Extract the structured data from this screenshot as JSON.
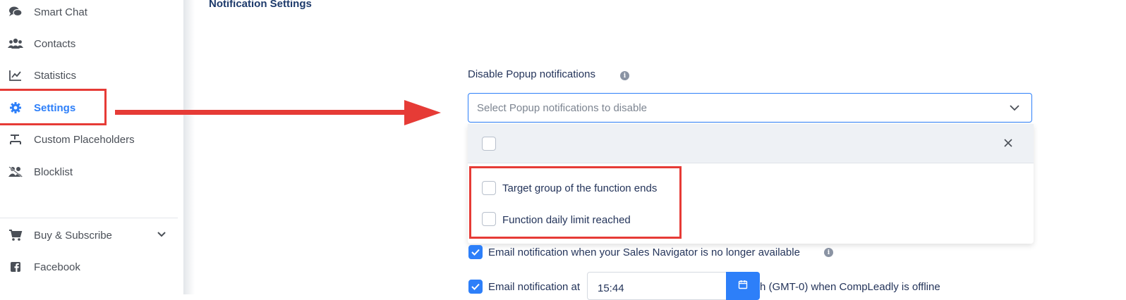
{
  "sidebar": {
    "items": [
      {
        "label": "Smart Chat",
        "icon": "chat-icon"
      },
      {
        "label": "Contacts",
        "icon": "users-icon"
      },
      {
        "label": "Statistics",
        "icon": "chart-line-icon"
      },
      {
        "label": "Settings",
        "icon": "gear-icon",
        "active": true
      },
      {
        "label": "Custom Placeholders",
        "icon": "placeholder-icon"
      },
      {
        "label": "Blocklist",
        "icon": "user-block-icon"
      }
    ],
    "bottom_items": [
      {
        "label": "Buy & Subscribe",
        "icon": "cart-icon",
        "has_submenu": true
      },
      {
        "label": "Facebook",
        "icon": "facebook-icon"
      }
    ]
  },
  "main": {
    "title": "Notification Settings",
    "popup_field": {
      "label": "Disable Popup notifications",
      "placeholder": "Select Popup notifications to disable",
      "options": [
        "Target group of the function ends",
        "Function daily limit reached"
      ]
    },
    "email_sales_nav": {
      "label": "Email notification when your Sales Navigator is no longer available",
      "checked": true
    },
    "email_offline": {
      "label_before": "Email notification at",
      "time_value": "15:44",
      "label_after": "h (GMT-0) when CompLeadly is offline",
      "checked": true
    }
  },
  "colors": {
    "accent": "#2d7ff9",
    "highlight": "#e63b36",
    "text": "#24345a"
  }
}
